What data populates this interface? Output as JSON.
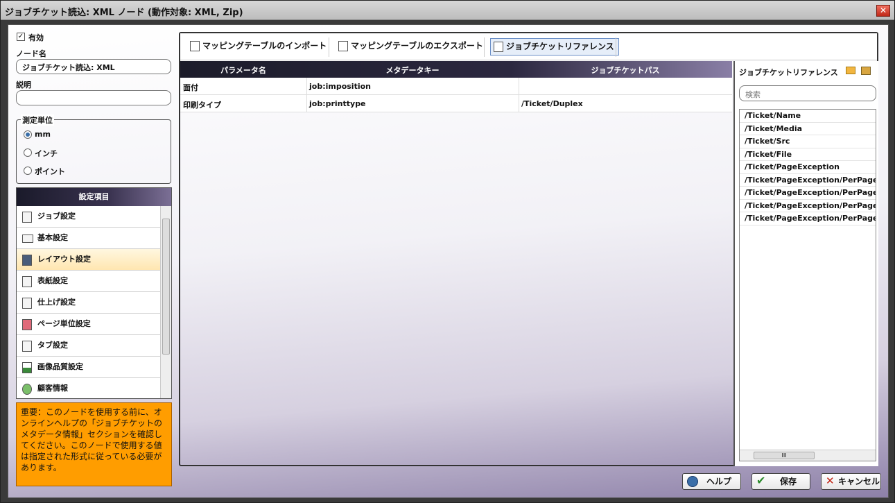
{
  "window": {
    "title": "ジョブチケット読込: XML ノード (動作対象: XML, Zip)",
    "close_label": "✕"
  },
  "left": {
    "enabled_label": "有効",
    "enabled_checked": true,
    "node_name_label": "ノード名",
    "node_name_value": "ジョブチケット読込: XML",
    "description_label": "説明",
    "description_value": "",
    "units": {
      "title": "測定単位",
      "options": [
        "mm",
        "インチ",
        "ポイント"
      ],
      "selected": "mm"
    },
    "settings": {
      "header": "設定項目",
      "items": [
        "ジョブ設定",
        "基本設定",
        "レイアウト設定",
        "表紙設定",
        "仕上げ設定",
        "ページ単位設定",
        "タブ設定",
        "画像品質設定",
        "顧客情報"
      ],
      "selected": "レイアウト設定"
    },
    "note": "重要：このノードを使用する前に、オンラインヘルプの「ジョブチケットのメタデータ情報」セクションを確認してください。このノードで使用する値は指定された形式に従っている必要があります。"
  },
  "toolbar": {
    "import_label": "マッピングテーブルのインポート",
    "export_label": "マッピングテーブルのエクスポート",
    "reference_label": "ジョブチケットリファレンス"
  },
  "table": {
    "columns": [
      "パラメータ名",
      "メタデータキー",
      "ジョブチケットパス"
    ],
    "rows": [
      [
        "面付",
        "job:imposition",
        ""
      ],
      [
        "印刷タイプ",
        "job:printtype",
        "/Ticket/Duplex"
      ]
    ]
  },
  "reference": {
    "title": "ジョブチケットリファレンス",
    "search_placeholder": "検索",
    "items": [
      "/Ticket/Name",
      "/Ticket/Media",
      "/Ticket/Src",
      "/Ticket/File",
      "/Ticket/PageException",
      "/Ticket/PageException/PerPage:",
      "/Ticket/PageException/PerPage:",
      "/Ticket/PageException/PerPage:",
      "/Ticket/PageException/PerPage:"
    ],
    "scroll_thumb": "III"
  },
  "buttons": {
    "help": "ヘルプ",
    "save": "保存",
    "cancel": "キャンセル"
  }
}
